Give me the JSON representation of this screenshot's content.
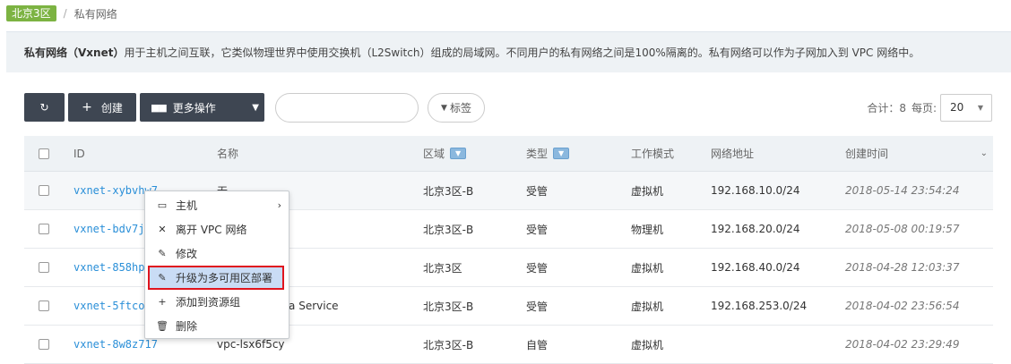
{
  "breadcrumb": {
    "zone": "北京3区",
    "separator": "/",
    "current": "私有网络"
  },
  "info": {
    "strong": "私有网络（Vxnet）",
    "text": "用于主机之间互联，它类似物理世界中使用交换机（L2Switch）组成的局域网。不同用户的私有网络之间是100%隔离的。私有网络可以作为子网加入到 VPC 网络中。"
  },
  "toolbar": {
    "refresh_icon": "refresh-icon",
    "create_label": "创建",
    "more_label": "更多操作",
    "tag_label": "标签",
    "search_placeholder": ""
  },
  "pager": {
    "total_label": "合计：8",
    "per_page_label": "每页:",
    "per_page_value": "20"
  },
  "table": {
    "headers": {
      "id": "ID",
      "name": "名称",
      "zone": "区域",
      "type": "类型",
      "mode": "工作模式",
      "network": "网络地址",
      "created": "创建时间"
    },
    "rows": [
      {
        "id": "vxnet-xybvhw7",
        "name": "无",
        "zone": "北京3区-B",
        "type": "受管",
        "mode": "虚拟机",
        "network": "192.168.10.0/24",
        "created": "2018-05-14 23:54:24"
      },
      {
        "id": "vxnet-bdv7j",
        "name": "",
        "zone": "北京3区-B",
        "type": "受管",
        "mode": "物理机",
        "network": "192.168.20.0/24",
        "created": "2018-05-08 00:19:57"
      },
      {
        "id": "vxnet-858hp",
        "name": "",
        "zone": "北京3区",
        "type": "受管",
        "mode": "虚拟机",
        "network": "192.168.40.0/24",
        "created": "2018-04-28 12:03:37"
      },
      {
        "id": "vxnet-5ftco",
        "name": "adata Service",
        "zone": "北京3区-B",
        "type": "受管",
        "mode": "虚拟机",
        "network": "192.168.253.0/24",
        "created": "2018-04-02 23:56:54"
      },
      {
        "id": "vxnet-8w8z717",
        "name": "vpc-lsx6f5cy",
        "zone": "北京3区-B",
        "type": "自管",
        "mode": "虚拟机",
        "network": "",
        "created": "2018-04-02 23:29:49"
      }
    ]
  },
  "context_menu": {
    "items": [
      {
        "icon": "monitor-icon",
        "label": "主机",
        "has_submenu": true
      },
      {
        "icon": "close-icon",
        "label": "离开 VPC 网络"
      },
      {
        "icon": "pencil-icon",
        "label": "修改"
      },
      {
        "icon": "pencil-icon",
        "label": "升级为多可用区部署",
        "highlighted": true
      },
      {
        "icon": "plus-icon",
        "label": "添加到资源组"
      },
      {
        "icon": "trash-icon",
        "label": "删除"
      }
    ]
  },
  "colors": {
    "zone_badge": "#7cb342",
    "toolbar_button": "#3e4652",
    "link": "#2a8fd8",
    "highlight_border": "#e0141e",
    "highlight_bg": "#c9dcf5"
  }
}
